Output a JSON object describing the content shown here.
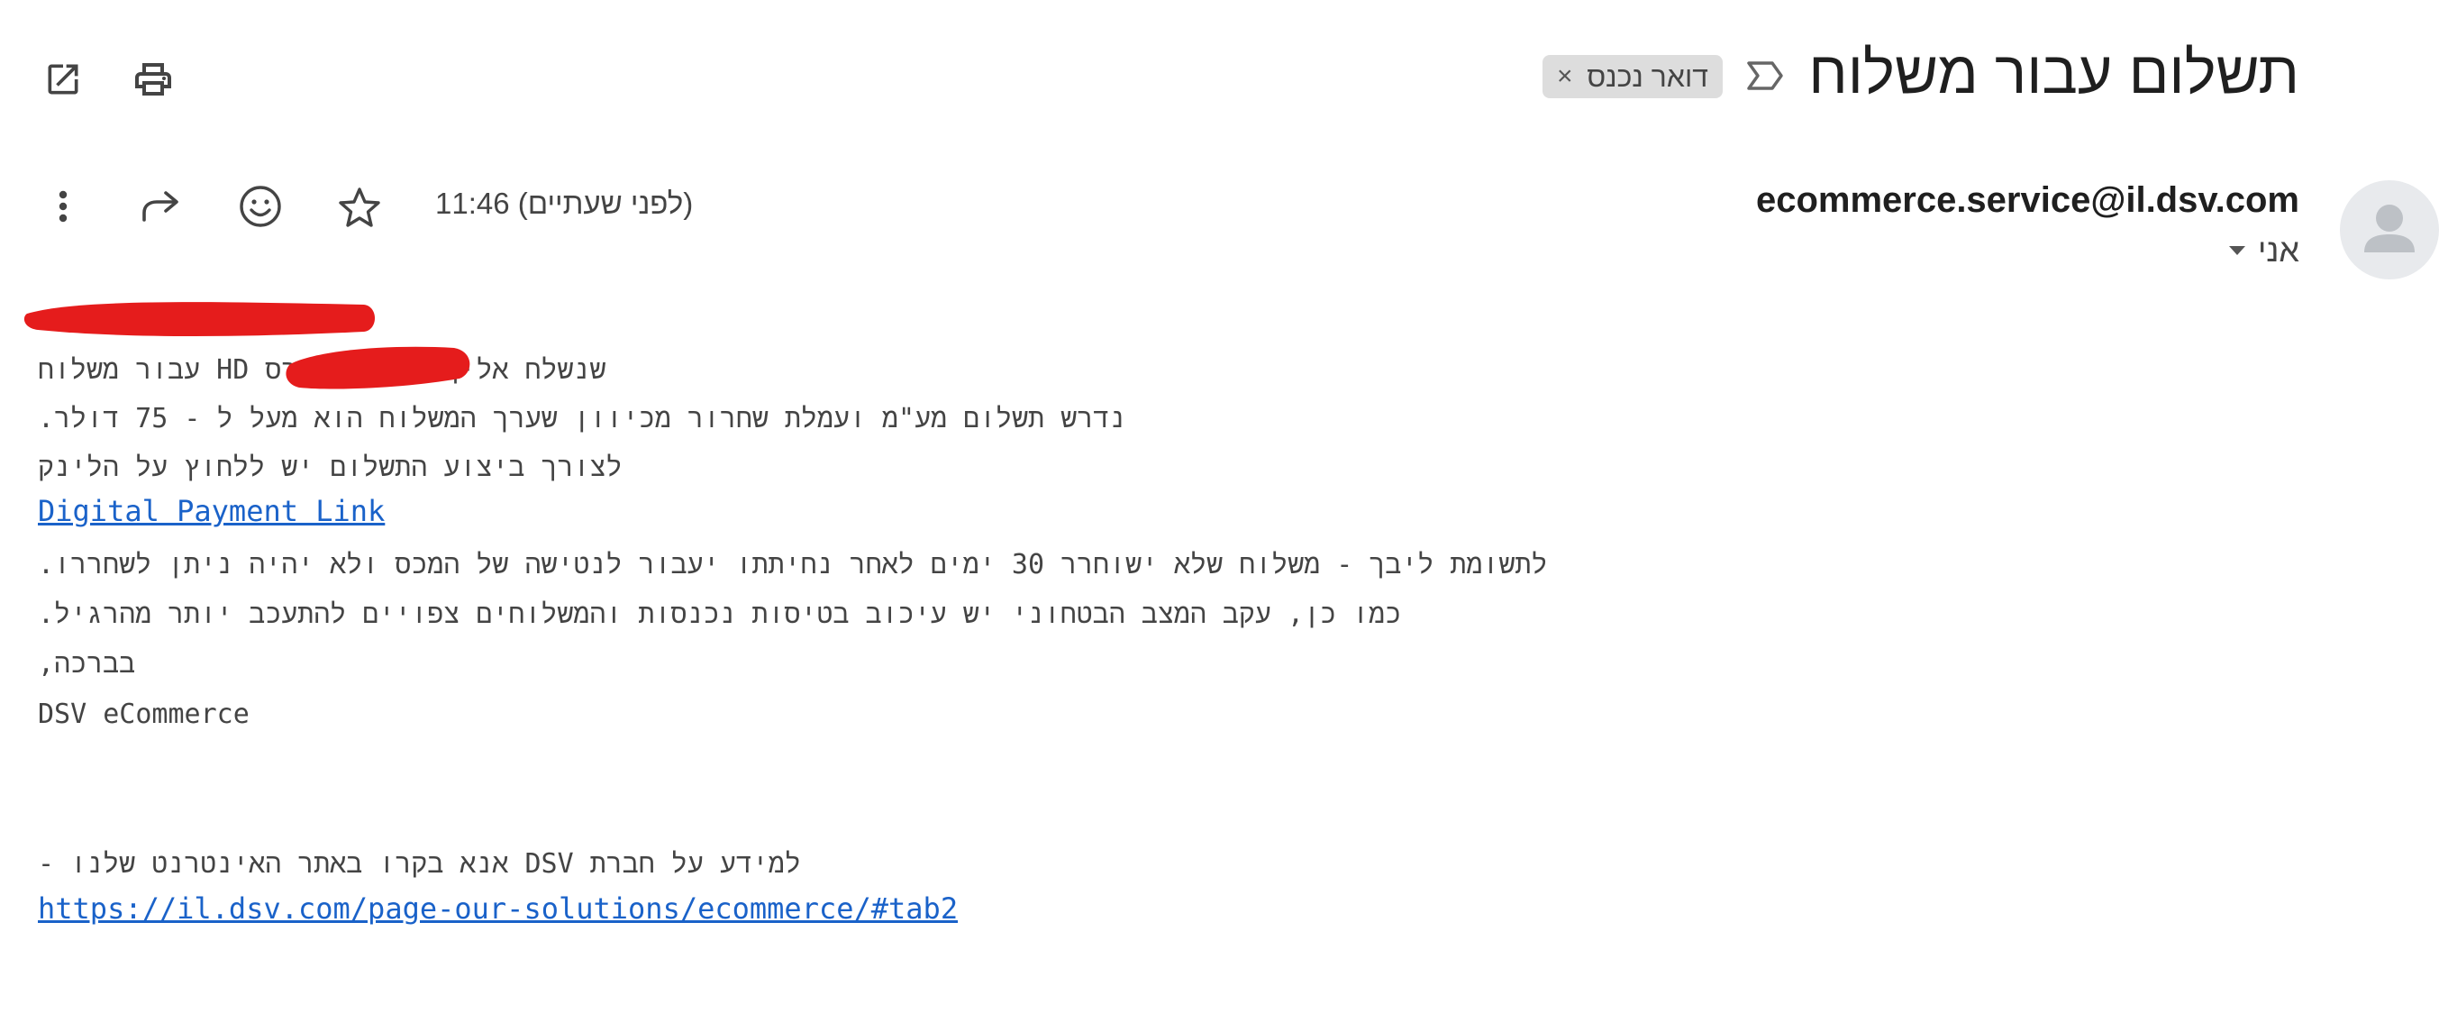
{
  "header": {
    "subject": "תשלום עבור משלוח",
    "label_chip": "דואר נכנס",
    "label_chip_close": "×",
    "importance_icon": "label-important-icon",
    "open_in_new_window_icon": "open-in-new-icon",
    "print_icon": "print-icon"
  },
  "message": {
    "sender_email": "ecommerce.service@il.dsv.com",
    "recipient": "אני",
    "timestamp": "11:46 (לפני שעתיים)",
    "actions": [
      "more-vert-icon",
      "forward-icon",
      "emoji-icon",
      "star-icon"
    ],
    "avatar_icon": "person-icon"
  },
  "body": {
    "line1": "שנשלח אליך מעליאקספרס HD עבור משלוח",
    "line2": "נדרש תשלום מע\"מ ועמלת שחרור מכיוון שערך המשלוח הוא מעל ל - 75 דולר.",
    "line3": "לצורך ביצוע התשלום יש ללחוץ על הלינק",
    "payment_link": "Digital Payment Link",
    "line4": "לתשומת ליבך - משלוח שלא ישוחרר 30 ימים לאחר נחיתתו יעבור לנטישה של המכס ולא יהיה ניתן לשחררו.",
    "line5": "כמו כן, עקב המצב הבטחוני יש עיכוב בטיסות נכנסות והמשלוחים צפויים להתעכב יותר מהרגיל.",
    "line6": "בברכה,",
    "signature": "DSV eCommerce",
    "line7": "למידע על חברת DSV אנא בקרו באתר האינטרנט שלנו -",
    "site_link": "https://il.dsv.com/page-our-solutions/ecommerce/#tab2"
  },
  "colors": {
    "link": "#1a62c9",
    "redaction": "#e51c1c",
    "chip_bg": "#dddddd"
  }
}
